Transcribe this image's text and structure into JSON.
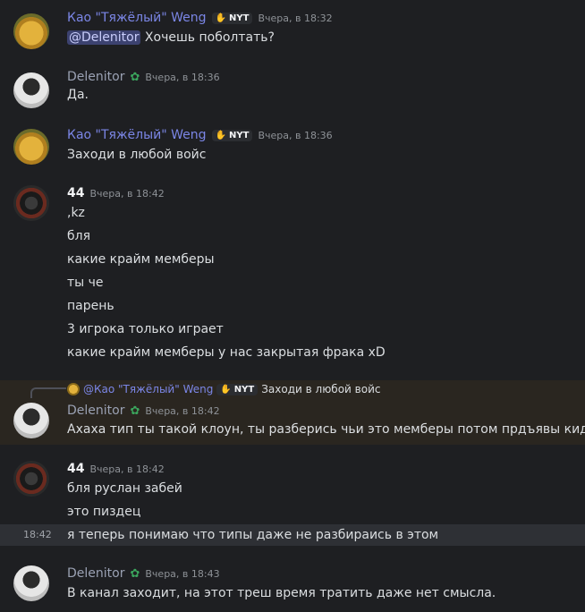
{
  "messages": [
    {
      "author": "Као \"Тяжёлый\" Weng",
      "badge": "NYT",
      "time": "Вчера, в 18:32",
      "mention": "@Delenitor",
      "text": " Хочешь поболтать?"
    },
    {
      "author": "Delenitor",
      "time": "Вчера, в 18:36",
      "text": "Да."
    },
    {
      "author": "Као \"Тяжёлый\" Weng",
      "badge": "NYT",
      "time": "Вчера, в 18:36",
      "text": "Заходи в любой войс"
    },
    {
      "author": "44",
      "time": "Вчера, в 18:42",
      "lines": [
        ",kz",
        "бля",
        "какие крайм мемберы",
        "ты че",
        "парень",
        "3 игрока только играет",
        "какие крайм мемберы у нас закрытая фрака xD"
      ]
    },
    {
      "reply": {
        "author": "@Као \"Тяжёлый\" Weng",
        "badge": "NYT",
        "text": "Заходи в любой войс"
      },
      "author": "Delenitor",
      "time": "Вчера, в 18:42",
      "text": "Ахаха тип ты такой клоун, ты разберись чьи это мемберы потом прдъявы кидай)"
    },
    {
      "author": "44",
      "time": "Вчера, в 18:42",
      "lines": [
        "бля руслан забей",
        "это пиздец",
        "я теперь понимаю что типы даже не разбираись в этом"
      ],
      "hover_time": "18:42"
    },
    {
      "author": "Delenitor",
      "time": "Вчера, в 18:43",
      "text": "В канал заходит, на этот треш время тратить даже нет смысла."
    }
  ],
  "colors": {
    "background": "#1e1f22",
    "kao_name": "#7b86e6",
    "delenitor_name": "#9aa1b3",
    "mention_bg": "#3c4270",
    "reply_highlight": "#2a2620"
  }
}
